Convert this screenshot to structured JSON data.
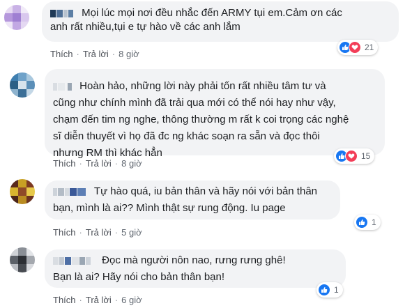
{
  "ui": {
    "like_label": "Thích",
    "reply_label": "Trả lời",
    "separator": "·"
  },
  "comments": [
    {
      "author_redacted": true,
      "text_lines": [
        "Mọi lúc mọi nơi đều nhắc đến ARMY tụi em.Cảm ơn các",
        "anh rất nhiều,tụi e tự hào về các anh lắm"
      ],
      "time": "8 giờ",
      "reactions": [
        "like-icon",
        "love-icon"
      ],
      "reaction_count": "21"
    },
    {
      "author_redacted": true,
      "text_lines": [
        "Hoàn hảo, những lời này phải tốn rất nhiều tâm tư và",
        "cũng như chính mình đã trải qua mới có thể nói hay như vậy,",
        "chạm đến tim ng nghe, thông thường m rất k coi trọng các nghệ",
        "sĩ diễn thuyết vì họ đã đc ng khác soạn ra sẵn và đọc thôi",
        "nhưng RM thì khác hẳn"
      ],
      "time": "8 giờ",
      "reactions": [
        "like-icon",
        "love-icon"
      ],
      "reaction_count": "15"
    },
    {
      "author_redacted": true,
      "text_lines": [
        "Tự hào quá, iu bản thân và hãy nói với bản thân",
        "bạn, mình là ai?? Mình thật sự rung động. Iu page"
      ],
      "time": "5 giờ",
      "reactions": [
        "like-icon"
      ],
      "reaction_count": "1"
    },
    {
      "author_redacted": true,
      "text_lines": [
        "Đọc mà người nôn nao, rưng rưng ghê!",
        "Bạn là ai? Hãy nói cho bản thân bạn!"
      ],
      "time": "6 giờ",
      "reactions": [
        "like-icon"
      ],
      "reaction_count": "1"
    }
  ],
  "colors": {
    "bubble": "#f2f3f5",
    "like_blue": "#1877f2",
    "love_red": "#f33e58",
    "meta_text": "#606770"
  }
}
